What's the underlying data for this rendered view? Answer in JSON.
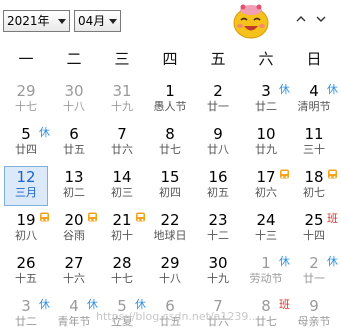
{
  "header": {
    "year_select": "2021年",
    "month_select": "04月"
  },
  "weekdays": [
    "一",
    "二",
    "三",
    "四",
    "五",
    "六",
    "日"
  ],
  "days": [
    {
      "num": "29",
      "lunar": "十七",
      "other": true,
      "badge": null
    },
    {
      "num": "30",
      "lunar": "十八",
      "other": true,
      "badge": null
    },
    {
      "num": "31",
      "lunar": "十九",
      "other": true,
      "badge": null
    },
    {
      "num": "1",
      "lunar": "愚人节",
      "other": false,
      "badge": null
    },
    {
      "num": "2",
      "lunar": "廿一",
      "other": false,
      "badge": null
    },
    {
      "num": "3",
      "lunar": "廿二",
      "other": false,
      "badge": "休"
    },
    {
      "num": "4",
      "lunar": "清明节",
      "other": false,
      "badge": "休"
    },
    {
      "num": "5",
      "lunar": "廿四",
      "other": false,
      "badge": "休"
    },
    {
      "num": "6",
      "lunar": "廿五",
      "other": false,
      "badge": null
    },
    {
      "num": "7",
      "lunar": "廿六",
      "other": false,
      "badge": null
    },
    {
      "num": "8",
      "lunar": "廿七",
      "other": false,
      "badge": null
    },
    {
      "num": "9",
      "lunar": "廿八",
      "other": false,
      "badge": null
    },
    {
      "num": "10",
      "lunar": "廿九",
      "other": false,
      "badge": null
    },
    {
      "num": "11",
      "lunar": "三十",
      "other": false,
      "badge": null
    },
    {
      "num": "12",
      "lunar": "三月",
      "other": false,
      "badge": null,
      "selected": true
    },
    {
      "num": "13",
      "lunar": "初二",
      "other": false,
      "badge": null
    },
    {
      "num": "14",
      "lunar": "初三",
      "other": false,
      "badge": null
    },
    {
      "num": "15",
      "lunar": "初四",
      "other": false,
      "badge": null
    },
    {
      "num": "16",
      "lunar": "初五",
      "other": false,
      "badge": null
    },
    {
      "num": "17",
      "lunar": "初六",
      "other": false,
      "badge": "bus"
    },
    {
      "num": "18",
      "lunar": "初七",
      "other": false,
      "badge": "bus"
    },
    {
      "num": "19",
      "lunar": "初八",
      "other": false,
      "badge": "bus"
    },
    {
      "num": "20",
      "lunar": "谷雨",
      "other": false,
      "badge": "bus"
    },
    {
      "num": "21",
      "lunar": "初十",
      "other": false,
      "badge": "bus"
    },
    {
      "num": "22",
      "lunar": "地球日",
      "other": false,
      "badge": null
    },
    {
      "num": "23",
      "lunar": "十二",
      "other": false,
      "badge": null
    },
    {
      "num": "24",
      "lunar": "十三",
      "other": false,
      "badge": null
    },
    {
      "num": "25",
      "lunar": "十四",
      "other": false,
      "badge": "班"
    },
    {
      "num": "26",
      "lunar": "十五",
      "other": false,
      "badge": null
    },
    {
      "num": "27",
      "lunar": "十六",
      "other": false,
      "badge": null
    },
    {
      "num": "28",
      "lunar": "十七",
      "other": false,
      "badge": null
    },
    {
      "num": "29",
      "lunar": "十八",
      "other": false,
      "badge": null
    },
    {
      "num": "30",
      "lunar": "十九",
      "other": false,
      "badge": null
    },
    {
      "num": "1",
      "lunar": "劳动节",
      "other": true,
      "badge": "休"
    },
    {
      "num": "2",
      "lunar": "廿一",
      "other": true,
      "badge": "休"
    },
    {
      "num": "3",
      "lunar": "廿二",
      "other": true,
      "badge": "休"
    },
    {
      "num": "4",
      "lunar": "青年节",
      "other": true,
      "badge": "休"
    },
    {
      "num": "5",
      "lunar": "立夏",
      "other": true,
      "badge": "休"
    },
    {
      "num": "6",
      "lunar": "廿五",
      "other": true,
      "badge": null
    },
    {
      "num": "7",
      "lunar": "廿六",
      "other": true,
      "badge": null
    },
    {
      "num": "8",
      "lunar": "廿七",
      "other": true,
      "badge": "班"
    },
    {
      "num": "9",
      "lunar": "母亲节",
      "other": true,
      "badge": null
    }
  ],
  "watermark": "https://blog.csdn.net/a1239...",
  "colors": {
    "rest_badge": "#2f8fe0",
    "work_badge": "#d9332f",
    "selected_bg": "#dbe9f8",
    "selected_border": "#7fb0de",
    "bus_icon": "#f2a21b"
  }
}
